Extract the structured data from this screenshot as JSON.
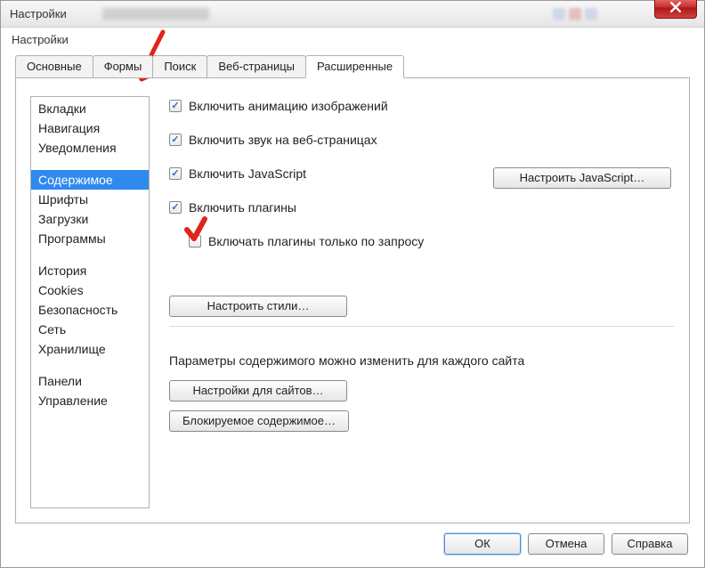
{
  "window": {
    "title": "Настройки"
  },
  "tabs": [
    {
      "label": "Основные",
      "active": false
    },
    {
      "label": "Формы",
      "active": false
    },
    {
      "label": "Поиск",
      "active": false
    },
    {
      "label": "Веб-страницы",
      "active": false
    },
    {
      "label": "Расширенные",
      "active": true
    }
  ],
  "sidebar": {
    "groups": [
      [
        "Вкладки",
        "Навигация",
        "Уведомления"
      ],
      [
        "Содержимое",
        "Шрифты",
        "Загрузки",
        "Программы"
      ],
      [
        "История",
        "Cookies",
        "Безопасность",
        "Сеть",
        "Хранилище"
      ],
      [
        "Панели",
        "Управление"
      ]
    ],
    "selected": "Содержимое"
  },
  "options": {
    "enable_anim": {
      "label": "Включить анимацию изображений",
      "checked": true
    },
    "enable_sound": {
      "label": "Включить звук на веб-страницах",
      "checked": true
    },
    "enable_js": {
      "label": "Включить JavaScript",
      "checked": true
    },
    "enable_plugins": {
      "label": "Включить плагины",
      "checked": true
    },
    "plugins_on_demand": {
      "label": "Включать плагины только по запросу",
      "checked": false
    }
  },
  "buttons": {
    "js_settings": "Настроить JavaScript…",
    "style_settings": "Настроить стили…",
    "site_settings": "Настройки для сайтов…",
    "blocked_content": "Блокируемое содержимое…"
  },
  "text": {
    "per_site": "Параметры содержимого можно изменить для каждого сайта"
  },
  "dialog": {
    "ok": "ОК",
    "cancel": "Отмена",
    "help": "Справка"
  }
}
